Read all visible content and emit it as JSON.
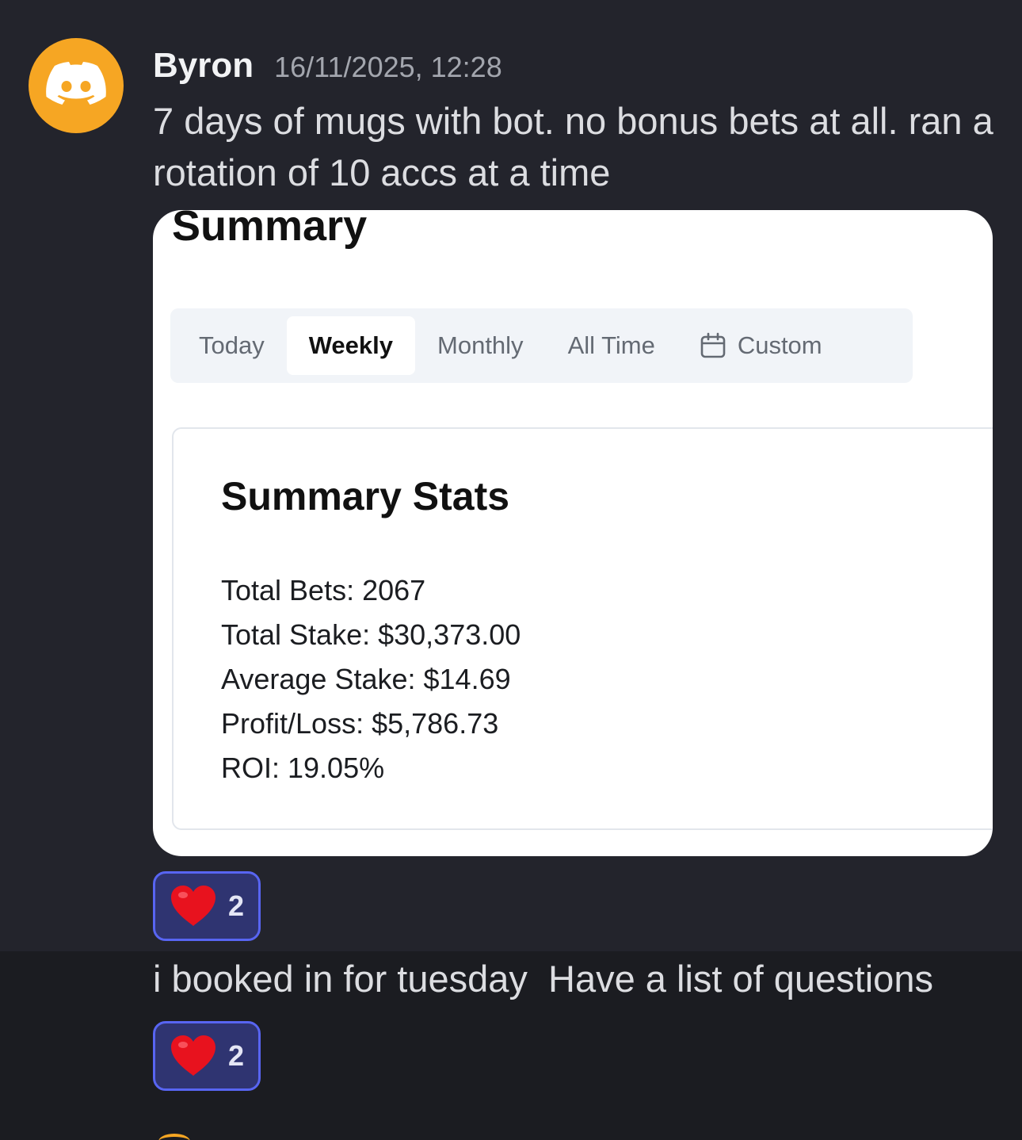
{
  "message1": {
    "username": "Byron",
    "timestamp": "16/11/2025, 12:28",
    "text": "7 days of mugs with bot. no bonus bets at all. ran a rotation of 10 accs at a time",
    "reaction": {
      "emoji": "heart",
      "count": "2"
    }
  },
  "embed": {
    "title": "Summary",
    "tabs": [
      {
        "label": "Today",
        "active": false
      },
      {
        "label": "Weekly",
        "active": true
      },
      {
        "label": "Monthly",
        "active": false
      },
      {
        "label": "All Time",
        "active": false
      },
      {
        "label": "Custom",
        "active": false,
        "icon": "calendar-icon"
      }
    ],
    "stats_title": "Summary Stats",
    "stats": [
      {
        "label": "Total Bets:",
        "value": "2067"
      },
      {
        "label": "Total Stake:",
        "value": "$30,373.00"
      },
      {
        "label": "Average Stake:",
        "value": "$14.69"
      },
      {
        "label": "Profit/Loss:",
        "value": "$5,786.73"
      },
      {
        "label": "ROI:",
        "value": "19.05%"
      }
    ]
  },
  "message2": {
    "text": "i booked in for tuesday  Have a list of questions",
    "reaction": {
      "emoji": "heart",
      "count": "2"
    }
  },
  "colors": {
    "background": "#23242c",
    "avatar": "#f6a623",
    "reaction_bg": "#2f3471",
    "reaction_border": "#5865f2",
    "heart": "#e8121e"
  }
}
